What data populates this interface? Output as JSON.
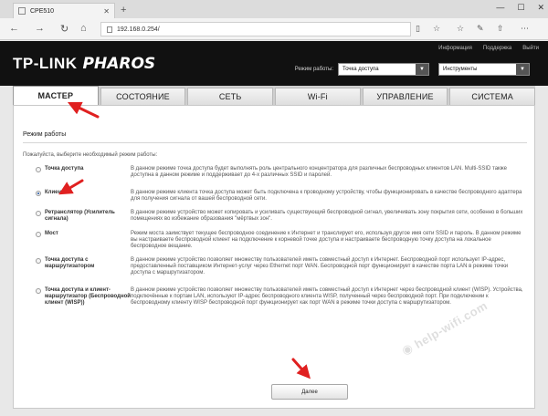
{
  "browser": {
    "tab_title": "CPE510",
    "url": "192.168.0.254/"
  },
  "header": {
    "links": [
      "Информация",
      "Поддержка",
      "Выйти"
    ],
    "logo_text": "TP-LINK",
    "logo_product": "PHAROS",
    "mode_label": "Режим работы:",
    "mode_value": "Точка доступа",
    "tools_value": "Инструменты"
  },
  "nav": {
    "tabs": [
      "МАСТЕР",
      "СОСТОЯНИЕ",
      "СЕТЬ",
      "Wi-Fi",
      "УПРАВЛЕНИЕ",
      "СИСТЕМА"
    ],
    "active_index": 0
  },
  "content": {
    "section_title": "Режим работы",
    "instruction": "Пожалуйста, выберите необходимый режим работы:",
    "options": [
      {
        "label": "Точка доступа",
        "desc": "В данном режиме точка доступа будет выполнять роль центрального концентратора для различных беспроводных клиентов LAN. Multi-SSID также доступна в данном режиме и поддерживает до 4-х различных SSID и паролей.",
        "checked": false
      },
      {
        "label": "Клиент",
        "desc": "В данном режиме клиента точка доступа может быть подключена к проводному устройству, чтобы функционировать в качестве беспроводного адаптера для получения сигнала от вашей беспроводной сети.",
        "checked": true
      },
      {
        "label": "Ретранслятор (Усилитель сигнала)",
        "desc": "В данном режиме устройство может копировать и усиливать существующий беспроводной сигнал, увеличивать зону покрытия сети, особенно в больших помещениях во избежание образования \"мёртвых зон\".",
        "checked": false
      },
      {
        "label": "Мост",
        "desc": "Режим моста заимствует текущее беспроводное соединение к Интернет и транслирует его, используя другое имя сети SSID и пароль. В данном режиме вы настраиваете беспроводной клиент на подключение к корневой точке доступа и настраиваете беспроводную точку доступа на локальное беспроводное вещание.",
        "checked": false
      },
      {
        "label": "Точка доступа с маршрутизатором",
        "desc": "В данном режиме устройство позволяет множеству пользователей иметь совместный доступ к Интернет. Беспроводной порт использует IP-адрес, предоставленный поставщиком Интернет-услуг через Ethernet порт WAN. Беспроводной порт функционирует в качестве порта LAN в режиме точки доступа с маршрутизатором.",
        "checked": false
      },
      {
        "label": "Точка доступа и клиент-маршрутизатор (Беспроводной клиент (WISP))",
        "desc": "В данном режиме устройство позволяет множеству пользователей иметь совместный доступ к Интернет через беспроводной клиент (WISP). Устройства, подключённые к портам LAN, используют IP-адрес беспроводного клиента WISP, полученный через беспроводной порт. При подключении к беспроводному клиенту WISP беспроводной порт функционирует как порт WAN в режиме точки доступа с маршрутизатором.",
        "checked": false
      }
    ],
    "next_label": "Далее"
  },
  "watermark": "help-wifi.com",
  "colors": {
    "annotation_arrow": "#e02020",
    "header_bg": "#111111",
    "radio_checked": "#1a4fa0"
  }
}
